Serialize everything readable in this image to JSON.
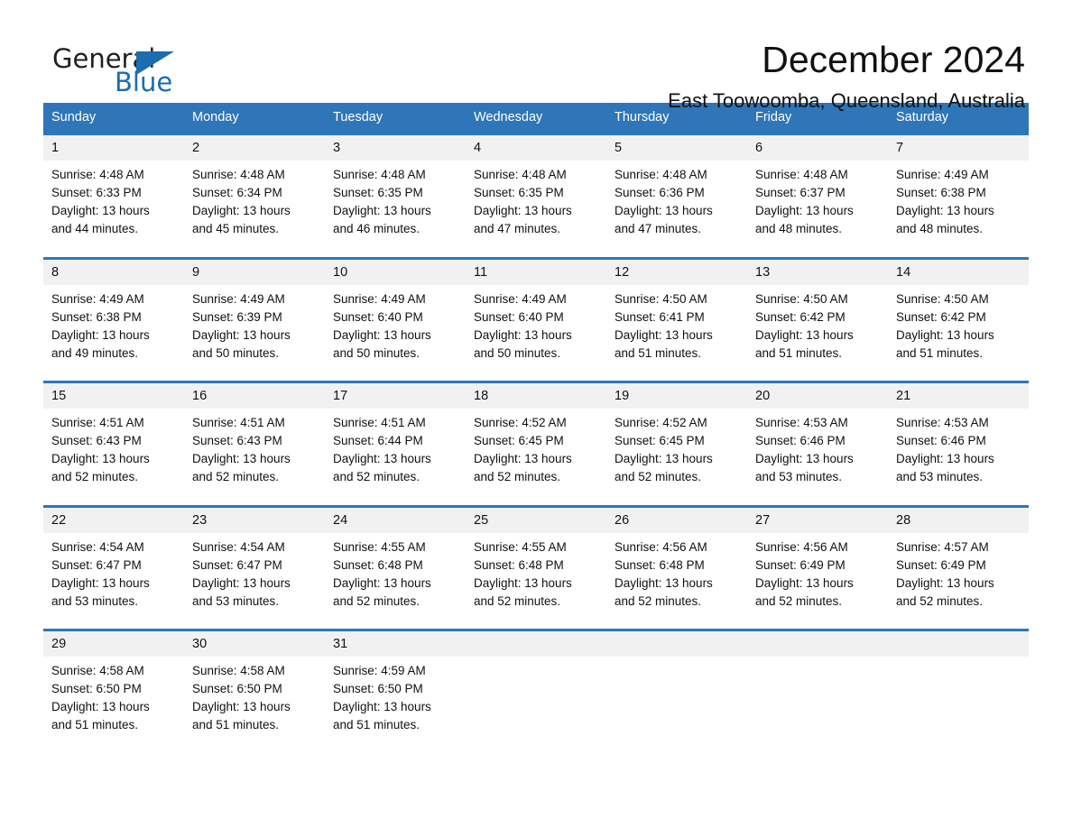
{
  "logo": {
    "word1": "General",
    "word2": "Blue",
    "accent_color": "#1b6cb0"
  },
  "header": {
    "month_title": "December 2024",
    "location": "East Toowoomba, Queensland, Australia"
  },
  "calendar": {
    "header_bg": "#2e76b8",
    "daynum_bg": "#f1f1f1",
    "weekdays": [
      "Sunday",
      "Monday",
      "Tuesday",
      "Wednesday",
      "Thursday",
      "Friday",
      "Saturday"
    ],
    "weeks": [
      [
        {
          "day": "1",
          "lines": [
            "Sunrise: 4:48 AM",
            "Sunset: 6:33 PM",
            "Daylight: 13 hours",
            "and 44 minutes."
          ]
        },
        {
          "day": "2",
          "lines": [
            "Sunrise: 4:48 AM",
            "Sunset: 6:34 PM",
            "Daylight: 13 hours",
            "and 45 minutes."
          ]
        },
        {
          "day": "3",
          "lines": [
            "Sunrise: 4:48 AM",
            "Sunset: 6:35 PM",
            "Daylight: 13 hours",
            "and 46 minutes."
          ]
        },
        {
          "day": "4",
          "lines": [
            "Sunrise: 4:48 AM",
            "Sunset: 6:35 PM",
            "Daylight: 13 hours",
            "and 47 minutes."
          ]
        },
        {
          "day": "5",
          "lines": [
            "Sunrise: 4:48 AM",
            "Sunset: 6:36 PM",
            "Daylight: 13 hours",
            "and 47 minutes."
          ]
        },
        {
          "day": "6",
          "lines": [
            "Sunrise: 4:48 AM",
            "Sunset: 6:37 PM",
            "Daylight: 13 hours",
            "and 48 minutes."
          ]
        },
        {
          "day": "7",
          "lines": [
            "Sunrise: 4:49 AM",
            "Sunset: 6:38 PM",
            "Daylight: 13 hours",
            "and 48 minutes."
          ]
        }
      ],
      [
        {
          "day": "8",
          "lines": [
            "Sunrise: 4:49 AM",
            "Sunset: 6:38 PM",
            "Daylight: 13 hours",
            "and 49 minutes."
          ]
        },
        {
          "day": "9",
          "lines": [
            "Sunrise: 4:49 AM",
            "Sunset: 6:39 PM",
            "Daylight: 13 hours",
            "and 50 minutes."
          ]
        },
        {
          "day": "10",
          "lines": [
            "Sunrise: 4:49 AM",
            "Sunset: 6:40 PM",
            "Daylight: 13 hours",
            "and 50 minutes."
          ]
        },
        {
          "day": "11",
          "lines": [
            "Sunrise: 4:49 AM",
            "Sunset: 6:40 PM",
            "Daylight: 13 hours",
            "and 50 minutes."
          ]
        },
        {
          "day": "12",
          "lines": [
            "Sunrise: 4:50 AM",
            "Sunset: 6:41 PM",
            "Daylight: 13 hours",
            "and 51 minutes."
          ]
        },
        {
          "day": "13",
          "lines": [
            "Sunrise: 4:50 AM",
            "Sunset: 6:42 PM",
            "Daylight: 13 hours",
            "and 51 minutes."
          ]
        },
        {
          "day": "14",
          "lines": [
            "Sunrise: 4:50 AM",
            "Sunset: 6:42 PM",
            "Daylight: 13 hours",
            "and 51 minutes."
          ]
        }
      ],
      [
        {
          "day": "15",
          "lines": [
            "Sunrise: 4:51 AM",
            "Sunset: 6:43 PM",
            "Daylight: 13 hours",
            "and 52 minutes."
          ]
        },
        {
          "day": "16",
          "lines": [
            "Sunrise: 4:51 AM",
            "Sunset: 6:43 PM",
            "Daylight: 13 hours",
            "and 52 minutes."
          ]
        },
        {
          "day": "17",
          "lines": [
            "Sunrise: 4:51 AM",
            "Sunset: 6:44 PM",
            "Daylight: 13 hours",
            "and 52 minutes."
          ]
        },
        {
          "day": "18",
          "lines": [
            "Sunrise: 4:52 AM",
            "Sunset: 6:45 PM",
            "Daylight: 13 hours",
            "and 52 minutes."
          ]
        },
        {
          "day": "19",
          "lines": [
            "Sunrise: 4:52 AM",
            "Sunset: 6:45 PM",
            "Daylight: 13 hours",
            "and 52 minutes."
          ]
        },
        {
          "day": "20",
          "lines": [
            "Sunrise: 4:53 AM",
            "Sunset: 6:46 PM",
            "Daylight: 13 hours",
            "and 53 minutes."
          ]
        },
        {
          "day": "21",
          "lines": [
            "Sunrise: 4:53 AM",
            "Sunset: 6:46 PM",
            "Daylight: 13 hours",
            "and 53 minutes."
          ]
        }
      ],
      [
        {
          "day": "22",
          "lines": [
            "Sunrise: 4:54 AM",
            "Sunset: 6:47 PM",
            "Daylight: 13 hours",
            "and 53 minutes."
          ]
        },
        {
          "day": "23",
          "lines": [
            "Sunrise: 4:54 AM",
            "Sunset: 6:47 PM",
            "Daylight: 13 hours",
            "and 53 minutes."
          ]
        },
        {
          "day": "24",
          "lines": [
            "Sunrise: 4:55 AM",
            "Sunset: 6:48 PM",
            "Daylight: 13 hours",
            "and 52 minutes."
          ]
        },
        {
          "day": "25",
          "lines": [
            "Sunrise: 4:55 AM",
            "Sunset: 6:48 PM",
            "Daylight: 13 hours",
            "and 52 minutes."
          ]
        },
        {
          "day": "26",
          "lines": [
            "Sunrise: 4:56 AM",
            "Sunset: 6:48 PM",
            "Daylight: 13 hours",
            "and 52 minutes."
          ]
        },
        {
          "day": "27",
          "lines": [
            "Sunrise: 4:56 AM",
            "Sunset: 6:49 PM",
            "Daylight: 13 hours",
            "and 52 minutes."
          ]
        },
        {
          "day": "28",
          "lines": [
            "Sunrise: 4:57 AM",
            "Sunset: 6:49 PM",
            "Daylight: 13 hours",
            "and 52 minutes."
          ]
        }
      ],
      [
        {
          "day": "29",
          "lines": [
            "Sunrise: 4:58 AM",
            "Sunset: 6:50 PM",
            "Daylight: 13 hours",
            "and 51 minutes."
          ]
        },
        {
          "day": "30",
          "lines": [
            "Sunrise: 4:58 AM",
            "Sunset: 6:50 PM",
            "Daylight: 13 hours",
            "and 51 minutes."
          ]
        },
        {
          "day": "31",
          "lines": [
            "Sunrise: 4:59 AM",
            "Sunset: 6:50 PM",
            "Daylight: 13 hours",
            "and 51 minutes."
          ]
        },
        {
          "day": "",
          "lines": []
        },
        {
          "day": "",
          "lines": []
        },
        {
          "day": "",
          "lines": []
        },
        {
          "day": "",
          "lines": []
        }
      ]
    ]
  }
}
